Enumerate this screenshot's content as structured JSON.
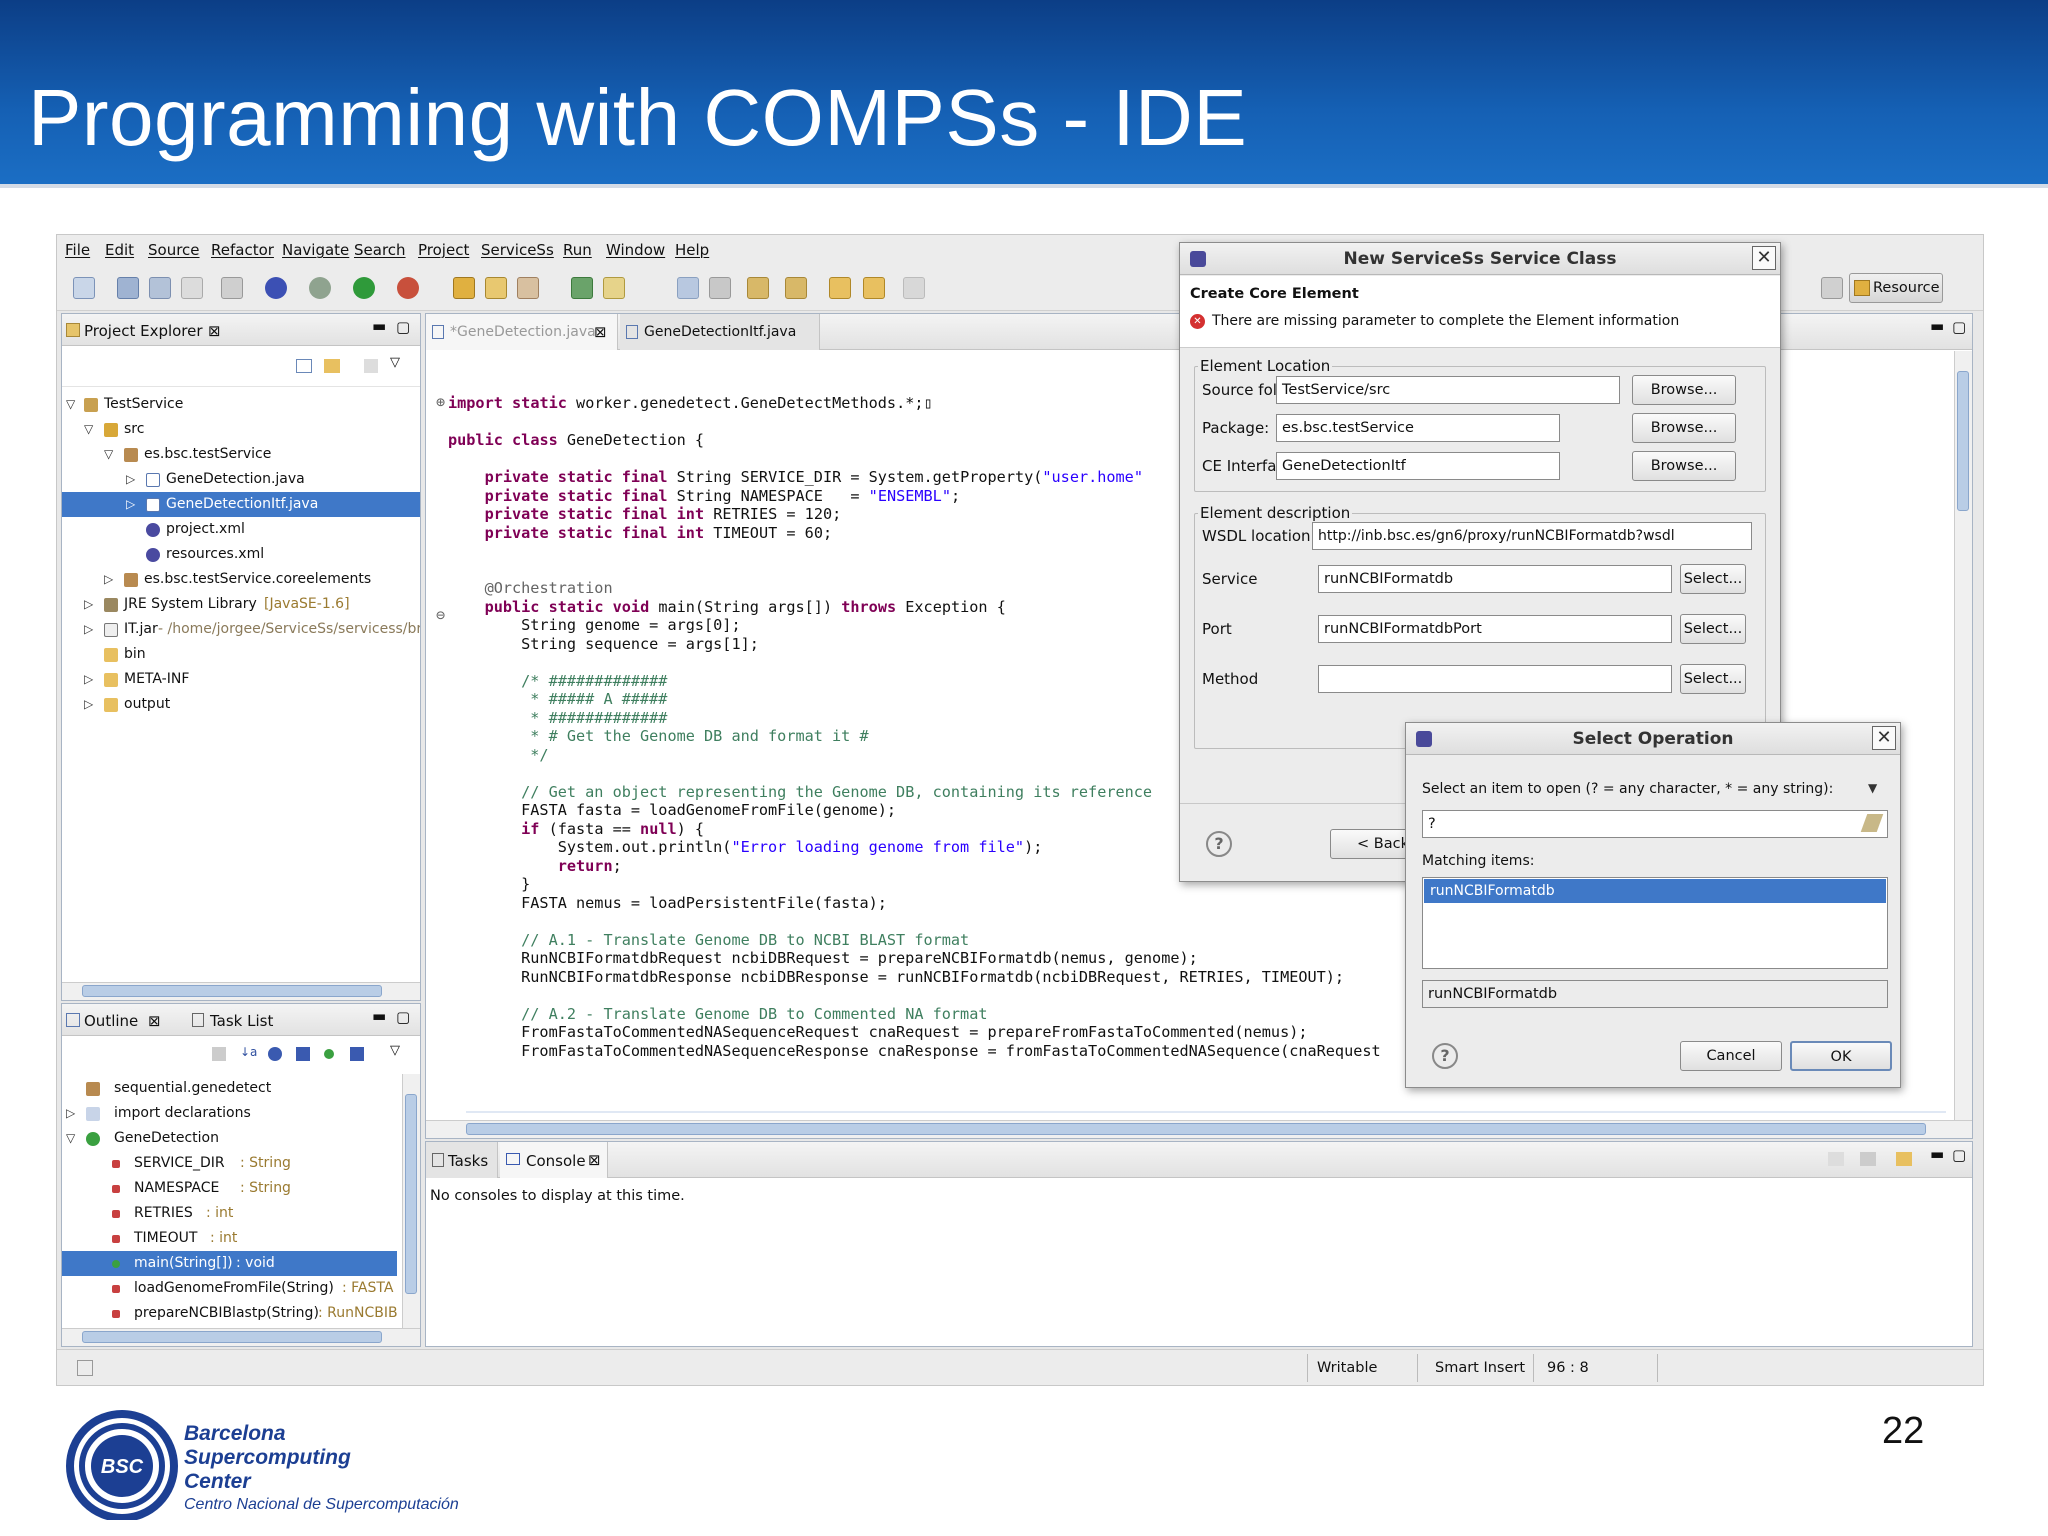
{
  "slide": {
    "title": "Programming with COMPSs - IDE",
    "page_number": "22",
    "footer": {
      "logo_initials": "BSC",
      "org_line1": "Barcelona",
      "org_line2": "Supercomputing",
      "org_line3": "Center",
      "org_subtitle": "Centro Nacional de Supercomputación"
    }
  },
  "ide": {
    "menu": [
      "File",
      "Edit",
      "Source",
      "Refactor",
      "Navigate",
      "Search",
      "Project",
      "ServiceSs",
      "Run",
      "Window",
      "Help"
    ],
    "perspective_label": "Resource",
    "project_explorer": {
      "tab": "Project Explorer",
      "items": [
        {
          "label": "TestService",
          "extra": ""
        },
        {
          "label": "src",
          "extra": ""
        },
        {
          "label": "es.bsc.testService",
          "extra": ""
        },
        {
          "label": "GeneDetection.java",
          "extra": ""
        },
        {
          "label": "GeneDetectionItf.java",
          "extra": ""
        },
        {
          "label": "project.xml",
          "extra": ""
        },
        {
          "label": "resources.xml",
          "extra": ""
        },
        {
          "label": "es.bsc.testService.coreelements",
          "extra": ""
        },
        {
          "label": "JRE System Library",
          "extra": "[JavaSE-1.6]"
        },
        {
          "label": "IT.jar",
          "extra": "- /home/jorgee/ServiceSs/servicess/bra"
        },
        {
          "label": "bin",
          "extra": ""
        },
        {
          "label": "META-INF",
          "extra": ""
        },
        {
          "label": "output",
          "extra": ""
        }
      ]
    },
    "outline": {
      "tab": "Outline",
      "tab2": "Task List",
      "items": [
        {
          "label": "sequential.genedetect",
          "type": ""
        },
        {
          "label": "import declarations",
          "type": ""
        },
        {
          "label": "GeneDetection",
          "type": ""
        },
        {
          "label": "SERVICE_DIR",
          "type": ": String"
        },
        {
          "label": "NAMESPACE",
          "type": ": String"
        },
        {
          "label": "RETRIES",
          "type": ": int"
        },
        {
          "label": "TIMEOUT",
          "type": ": int"
        },
        {
          "label": "main(String[])",
          "type": ": void"
        },
        {
          "label": "loadGenomeFromFile(String)",
          "type": ": FASTA"
        },
        {
          "label": "prepareNCBIBlastp(String)",
          "type": ": RunNCBIBl"
        }
      ]
    },
    "editor": {
      "tabs": [
        "*GeneDetection.java",
        "GeneDetectionItf.java"
      ]
    },
    "console": {
      "tab1": "Tasks",
      "tab2": "Console",
      "message": "No consoles to display at this time."
    },
    "status": {
      "writable": "Writable",
      "insert_mode": "Smart Insert",
      "position": "96 : 8"
    }
  },
  "new_class_dialog": {
    "title": "New ServiceSs Service Class",
    "header": "Create Core Element",
    "error": "There are missing parameter to complete the Element information",
    "location_group": "Element Location",
    "source_folder_label": "Source folder:",
    "source_folder": "TestService/src",
    "package_label": "Package:",
    "package": "es.bsc.testService",
    "ce_interface_label": "CE Interface",
    "ce_interface": "GeneDetectionItf",
    "browse": "Browse...",
    "description_group": "Element description",
    "wsdl_label": "WSDL location",
    "wsdl": "http://inb.bsc.es/gn6/proxy/runNCBIFormatdb?wsdl",
    "service_label": "Service",
    "service": "runNCBIFormatdb",
    "port_label": "Port",
    "port": "runNCBIFormatdbPort",
    "method_label": "Method",
    "method": "",
    "select": "Select...",
    "back": "< Back"
  },
  "select_operation_dialog": {
    "title": "Select Operation",
    "prompt": "Select an item to open (? = any character, * = any string):",
    "filter": "?",
    "matching_label": "Matching items:",
    "matching": [
      "runNCBIFormatdb"
    ],
    "selected_detail": "runNCBIFormatdb",
    "cancel": "Cancel",
    "ok": "OK"
  }
}
